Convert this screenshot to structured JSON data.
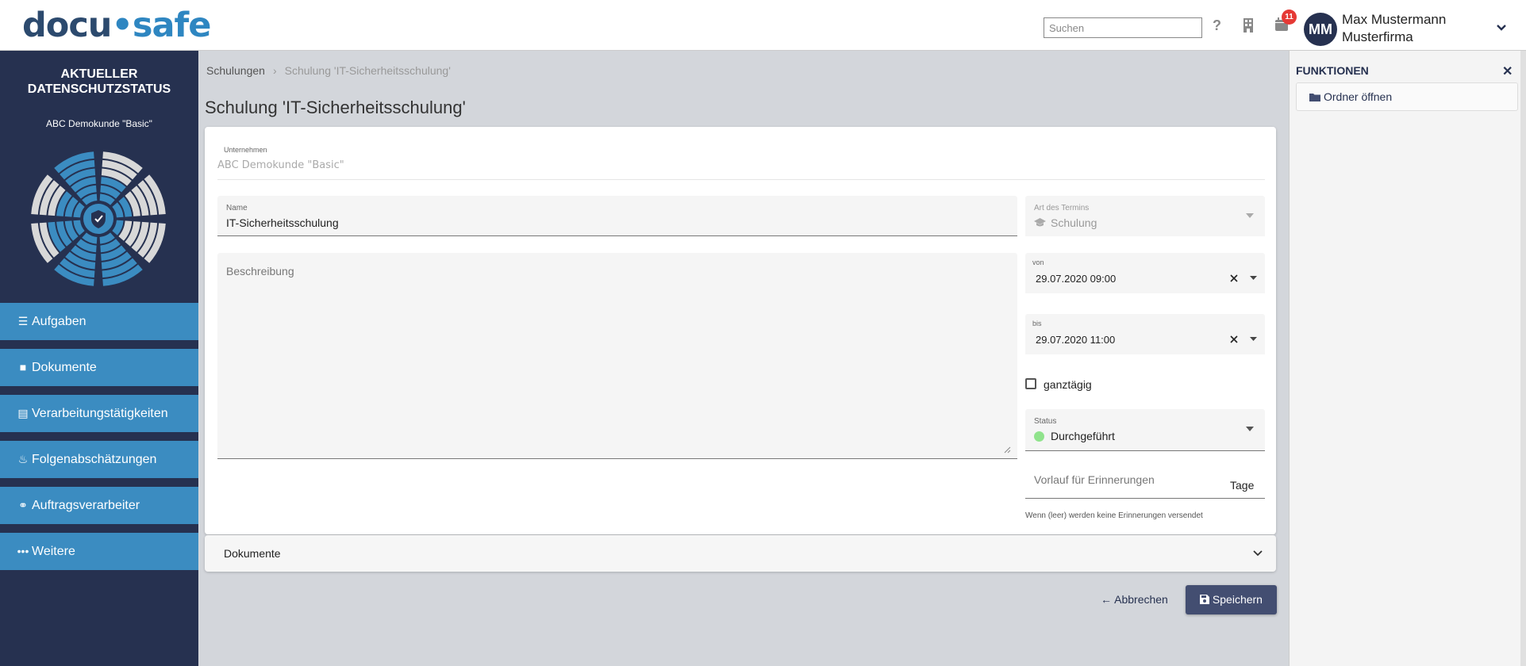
{
  "app": {
    "logo_part1": "docu",
    "logo_dot": "•",
    "logo_part2": "safe"
  },
  "topbar": {
    "search_placeholder": "Suchen",
    "help_icon": "?",
    "notification_count": "11",
    "avatar_initials": "MM",
    "user_name": "Max Mustermann",
    "user_company": "Musterfirma"
  },
  "sidebar": {
    "title_line1": "AKTUELLER",
    "title_line2": "DATENSCHUTZSTATUS",
    "client": "ABC Demokunde \"Basic\"",
    "items": [
      {
        "label": "Aufgaben",
        "icon": "tasks-icon",
        "glyph": "☰"
      },
      {
        "label": "Dokumente",
        "icon": "folder-icon",
        "glyph": "■"
      },
      {
        "label": "Verarbeitungstätigkeiten",
        "icon": "file-icon",
        "glyph": "▤"
      },
      {
        "label": "Folgenabschätzungen",
        "icon": "fire-icon",
        "glyph": "♨"
      },
      {
        "label": "Auftragsverarbeiter",
        "icon": "handshake-icon",
        "glyph": "⚭"
      },
      {
        "label": "Weitere",
        "icon": "more-icon",
        "glyph": "•••"
      }
    ]
  },
  "breadcrumb": {
    "parent": "Schulungen",
    "separator": "›",
    "current": "Schulung 'IT-Sicherheitsschulung'"
  },
  "page_title": "Schulung 'IT-Sicherheitsschulung'",
  "form": {
    "company_label": "Unternehmen",
    "company_value": "ABC Demokunde \"Basic\"",
    "name_label": "Name",
    "name_value": "IT-Sicherheitsschulung",
    "description_placeholder": "Beschreibung",
    "type_label": "Art des Termins",
    "type_value": "Schulung",
    "from_label": "von",
    "from_value": "29.07.2020 09:00",
    "to_label": "bis",
    "to_value": "29.07.2020 11:00",
    "allday_label": "ganztägig",
    "status_label": "Status",
    "status_value": "Durchgeführt",
    "status_color": "#90e38c",
    "reminder_placeholder": "Vorlauf für Erinnerungen",
    "reminder_unit": "Tage",
    "reminder_hint": "Wenn (leer) werden keine Erinnerungen versendet"
  },
  "documents_section": {
    "label": "Dokumente"
  },
  "actions": {
    "cancel": "Abbrechen",
    "save": "Speichern"
  },
  "right_panel": {
    "title": "FUNKTIONEN",
    "open_folder": "Ordner öffnen"
  },
  "colors": {
    "sidebar_bg": "#263150",
    "nav_bg": "#3b8cc1",
    "accent": "#434e71"
  }
}
